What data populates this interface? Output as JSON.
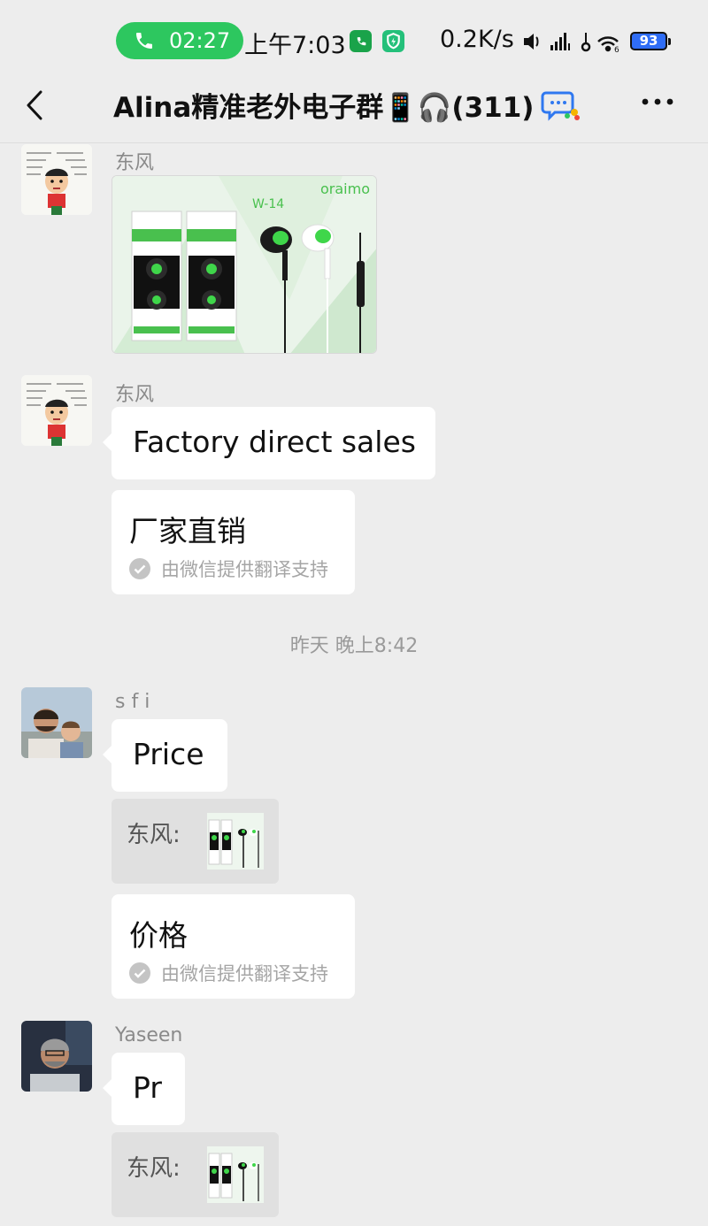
{
  "status_bar": {
    "call_timer": "02:27",
    "time": "上午7:03",
    "net_speed": "0.2K/s",
    "battery": "93"
  },
  "nav": {
    "title": "Alina精准老外电子群📱🎧(311)"
  },
  "messages": [
    {
      "sender": "东风",
      "type": "image",
      "image": {
        "brand": "oraimo",
        "model": "W-14"
      }
    },
    {
      "sender": "东风",
      "type": "text",
      "text": "Factory direct sales",
      "translation": "厂家直销",
      "translation_note": "由微信提供翻译支持"
    },
    {
      "type": "timestamp",
      "text": "昨天 晚上8:42"
    },
    {
      "sender": "s f i",
      "type": "text",
      "text": "Price",
      "quote_label": "东风:",
      "translation": "价格",
      "translation_note": "由微信提供翻译支持"
    },
    {
      "sender": "Yaseen",
      "type": "text",
      "text": "Pr",
      "quote_label": "东风:"
    }
  ],
  "colors": {
    "call_green": "#2dc75f",
    "chat_bg": "#ededed",
    "bubble": "#ffffff",
    "quote_bg": "#e0e0e0",
    "battery_blue": "#2f6df6"
  }
}
